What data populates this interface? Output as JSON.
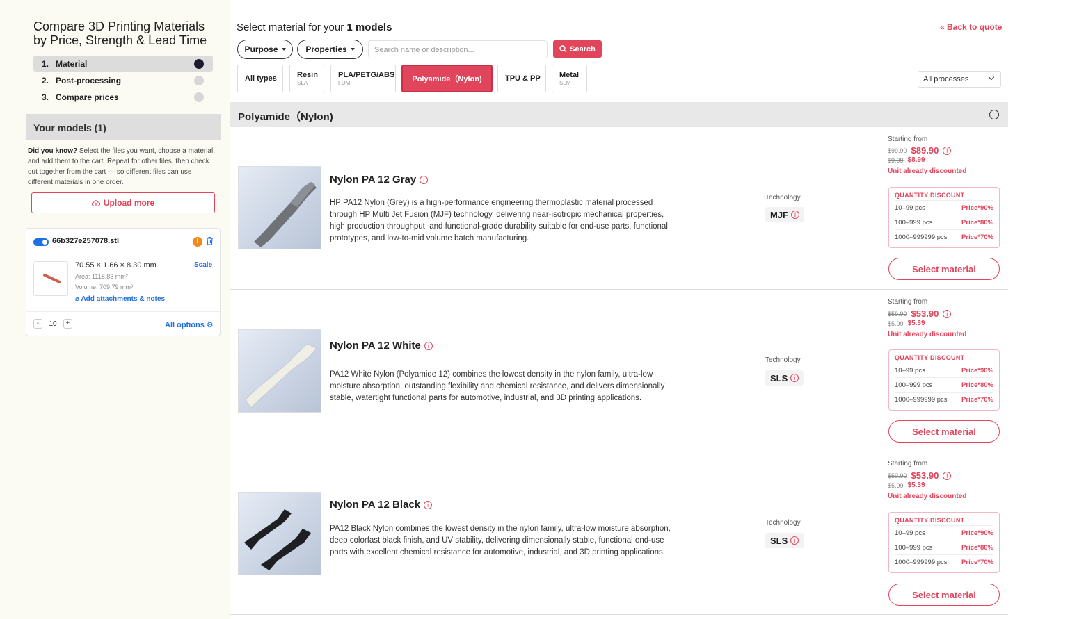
{
  "sidebar": {
    "title": "Compare 3D Printing Materials by Price, Strength & Lead Time",
    "steps": [
      {
        "num": "1.",
        "label": "Material"
      },
      {
        "num": "2.",
        "label": "Post-processing"
      },
      {
        "num": "3.",
        "label": "Compare prices"
      }
    ],
    "models_header": "Your models (1)",
    "tip_bold": "Did you know?",
    "tip_text": " Select the files you want, choose a material, and add them to the cart. Repeat for other files, then check out together from the cart — so different files can use different materials in one order.",
    "upload_label": "Upload more",
    "model": {
      "filename": "66b327e257078.stl",
      "dims": "70.55 × 1.66 × 8.30 mm",
      "area": "Area: 1118.83 mm²",
      "volume": "Volume: 709.79 mm³",
      "attach": "Add attachments & notes",
      "scale": "Scale",
      "qty": "10",
      "minus": "-",
      "plus": "+",
      "all_options": "All options"
    }
  },
  "header": {
    "select_prefix": "Select material for your ",
    "select_count": "1 models",
    "back": "Back to quote",
    "purpose": "Purpose",
    "properties": "Properties",
    "search_placeholder": "Search name or description...",
    "search_btn": "Search",
    "process_select": "All processes"
  },
  "tabs": [
    {
      "label": "All types",
      "sub": ""
    },
    {
      "label": "Resin",
      "sub": "SLA"
    },
    {
      "label": "PLA/PETG/ABS",
      "sub": "FDM"
    },
    {
      "label": "Polyamide（Nylon)",
      "sub": ""
    },
    {
      "label": "TPU & PP",
      "sub": ""
    },
    {
      "label": "Metal",
      "sub": "SLM"
    }
  ],
  "section": {
    "title": "Polyamide（Nylon)"
  },
  "materials": [
    {
      "name": "Nylon PA 12 Gray",
      "desc": "HP PA12 Nylon (Grey) is a high-performance engineering thermoplastic material processed through HP Multi Jet Fusion (MJF) technology, delivering near-isotropic mechanical properties, high production throughput, and functional-grade durability suitable for end-use parts, functional prototypes, and low-to-mid volume batch manufacturing.",
      "tech_label": "Technology",
      "tech": "MJF",
      "starting": "Starting from",
      "old_price": "$99.90",
      "price": "$89.90",
      "old_unit": "$9.99",
      "unit": "$8.99",
      "note": "Unit already discounted",
      "qd_title": "QUANTITY DISCOUNT",
      "discounts": [
        [
          "10–99 pcs",
          "Price*90%"
        ],
        [
          "100–999 pcs",
          "Price*80%"
        ],
        [
          "1000–999999 pcs",
          "Price*70%"
        ]
      ],
      "button": "Select material"
    },
    {
      "name": "Nylon PA 12 White",
      "desc": "PA12 White Nylon (Polyamide 12) combines the lowest density in the nylon family, ultra-low moisture absorption, outstanding flexibility and chemical resistance, and delivers dimensionally stable, watertight functional parts for automotive, industrial, and 3D printing applications.",
      "tech_label": "Technology",
      "tech": "SLS",
      "starting": "Starting from",
      "old_price": "$59.90",
      "price": "$53.90",
      "old_unit": "$5.99",
      "unit": "$5.39",
      "note": "Unit already discounted",
      "qd_title": "QUANTITY DISCOUNT",
      "discounts": [
        [
          "10–99 pcs",
          "Price*90%"
        ],
        [
          "100–999 pcs",
          "Price*80%"
        ],
        [
          "1000–999999 pcs",
          "Price*70%"
        ]
      ],
      "button": "Select material"
    },
    {
      "name": "Nylon PA 12 Black",
      "desc": "PA12 Black Nylon combines the lowest density in the nylon family, ultra-low moisture absorption, deep colorfast black finish, and UV stability, delivering dimensionally stable, functional end-use parts with excellent chemical resistance for automotive, industrial, and 3D printing applications.",
      "tech_label": "Technology",
      "tech": "SLS",
      "starting": "Starting from",
      "old_price": "$59.90",
      "price": "$53.90",
      "old_unit": "$5.99",
      "unit": "$5.39",
      "note": "Unit already discounted",
      "qd_title": "QUANTITY DISCOUNT",
      "discounts": [
        [
          "10–99 pcs",
          "Price*90%"
        ],
        [
          "100–999 pcs",
          "Price*80%"
        ],
        [
          "1000–999999 pcs",
          "Price*70%"
        ]
      ],
      "button": "Select material"
    }
  ],
  "colors": {
    "accent": "#e0455c",
    "link": "#1f6fe6",
    "warn": "#f08a1c"
  }
}
